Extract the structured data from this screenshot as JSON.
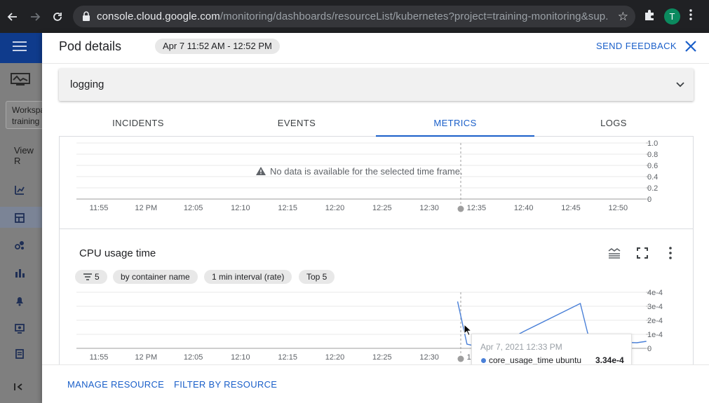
{
  "browser": {
    "url_host": "console.cloud.google.com",
    "url_path": "/monitoring/dashboards/resourceList/kubernetes?project=training-monitoring&sup...",
    "profile_initial": "T",
    "icons": [
      "back-arrow-icon",
      "forward-arrow-icon",
      "reload-icon",
      "lock-icon",
      "star-icon",
      "extensions-icon",
      "kebab-menu-icon"
    ]
  },
  "console": {
    "workspace_line1": "Workspa",
    "workspace_line2": "training",
    "view_label": "View R"
  },
  "panel": {
    "title": "Pod details",
    "time_range": "Apr 7 11:52 AM - 12:52 PM",
    "send_feedback": "SEND FEEDBACK"
  },
  "section": {
    "label": "logging"
  },
  "tabs": [
    {
      "label": "INCIDENTS"
    },
    {
      "label": "EVENTS"
    },
    {
      "label": "METRICS",
      "active": true
    },
    {
      "label": "LOGS"
    }
  ],
  "colors": {
    "accent": "#1a5fc9",
    "series": "#4a80d8"
  },
  "charts": {
    "top": {
      "no_data_text": "No data is available for the selected time frame."
    },
    "cpu": {
      "title": "CPU usage time",
      "chips": [
        "5",
        "by container name",
        "1 min interval (rate)",
        "Top 5"
      ]
    }
  },
  "tooltip": {
    "date": "Apr 7, 2021 12:33 PM",
    "series_name": "core_usage_time ubuntu",
    "value": "3.34e-4"
  },
  "footer": {
    "manage_resource": "MANAGE RESOURCE",
    "filter_by_resource": "FILTER BY RESOURCE"
  },
  "chart_data": [
    {
      "type": "line",
      "title": "",
      "x": [
        "11:55",
        "12 PM",
        "12:05",
        "12:10",
        "12:15",
        "12:20",
        "12:25",
        "12:30",
        "12:35",
        "12:40",
        "12:45",
        "12:50"
      ],
      "y_ticks": [
        "0",
        "0.2",
        "0.4",
        "0.6",
        "0.8",
        "1.0"
      ],
      "ylim": [
        0,
        1.0
      ],
      "series": [],
      "grid": true
    },
    {
      "type": "line",
      "title": "CPU usage time",
      "x": [
        "11:55",
        "12 PM",
        "12:05",
        "12:10",
        "12:15",
        "12:20",
        "12:25",
        "12:30",
        "12:35"
      ],
      "y_ticks": [
        "0",
        "1e-4",
        "2e-4",
        "3e-4",
        "4e-4"
      ],
      "ylim": [
        0,
        0.0004
      ],
      "grid": true,
      "series": [
        {
          "name": "core_usage_time ubuntu",
          "color": "#4a80d8",
          "points": [
            {
              "t": "12:33",
              "v": 0.000334
            },
            {
              "t": "12:34",
              "v": 3e-05
            },
            {
              "t": "12:35",
              "v": 1.5e-05
            },
            {
              "t": "12:36",
              "v": 5e-06
            },
            {
              "t": "12:37",
              "v": 1e-05
            },
            {
              "t": "12:40",
              "v": 0.00012
            },
            {
              "t": "12:46",
              "v": 0.00032
            },
            {
              "t": "12:47",
              "v": 5e-05
            },
            {
              "t": "12:52",
              "v": 4e-05
            },
            {
              "t": "12:53",
              "v": 5e-05
            }
          ]
        }
      ]
    }
  ]
}
